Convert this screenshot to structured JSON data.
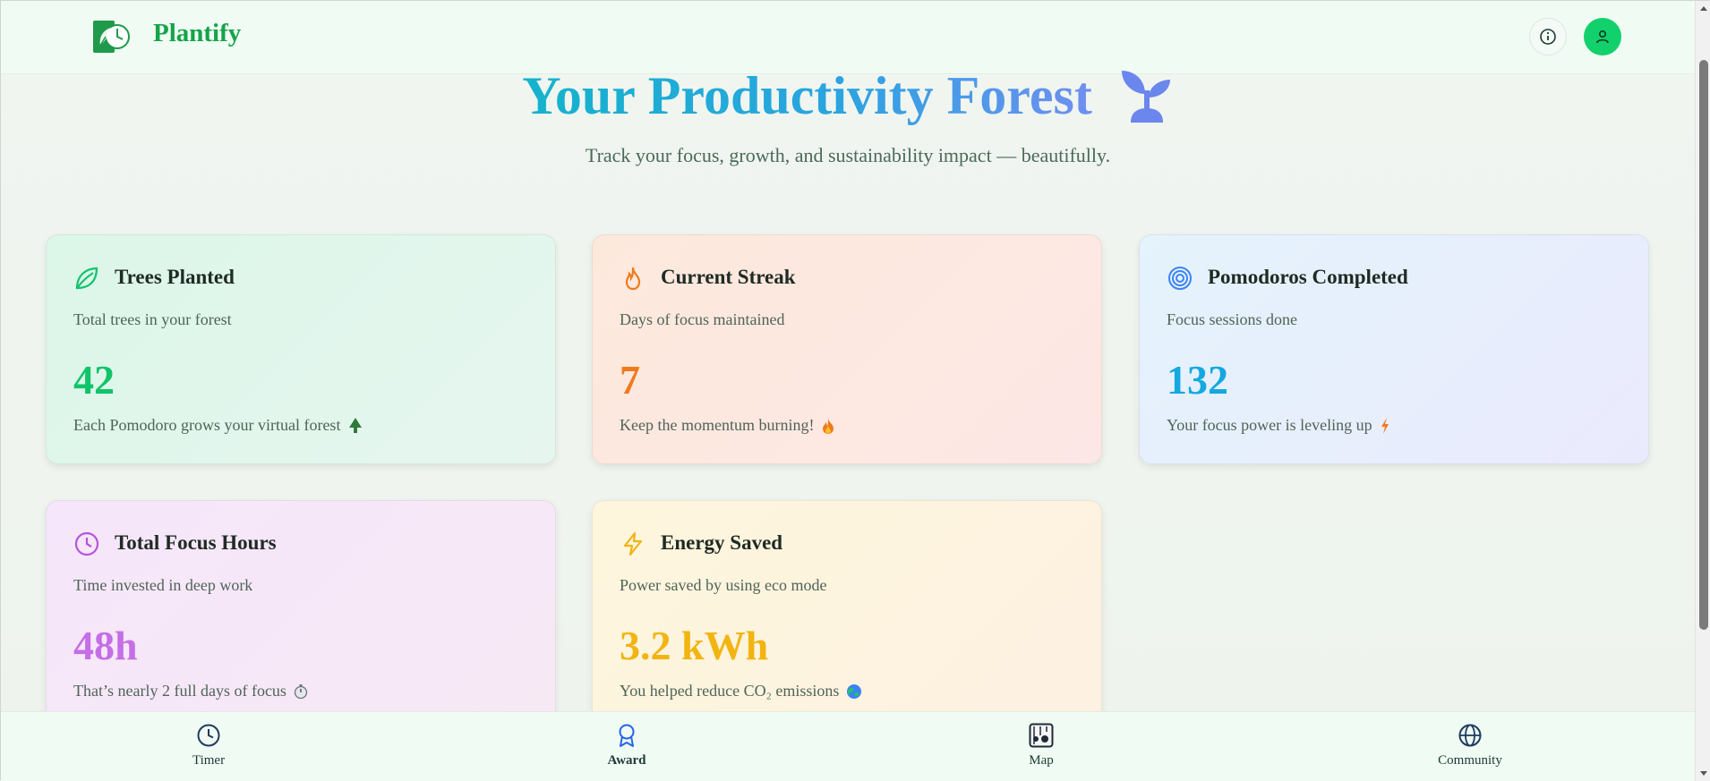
{
  "app": {
    "name": "Plantify"
  },
  "header": {
    "info_icon": "info-icon",
    "profile_icon": "user-icon"
  },
  "hero": {
    "title": "Your Productivity Forest",
    "subtitle": "Track your focus, growth, and sustainability impact — beautifully.",
    "icon": "sprout-icon"
  },
  "cards": [
    {
      "title": "Trees Planted",
      "desc": "Total trees in your forest",
      "value": "42",
      "note": "Each Pomodoro grows your virtual forest",
      "icon": "leaf-icon",
      "note_icon": "tree-icon",
      "color": "#10c46a"
    },
    {
      "title": "Current Streak",
      "desc": "Days of focus maintained",
      "value": "7",
      "note": "Keep the momentum burning!",
      "icon": "flame-icon",
      "note_icon": "fire-icon",
      "color": "#f07a1c"
    },
    {
      "title": "Pomodoros Completed",
      "desc": "Focus sessions done",
      "value": "132",
      "note": "Your focus power is leveling up",
      "icon": "target-icon",
      "note_icon": "lightning-icon",
      "color": "#14a8e0"
    },
    {
      "title": "Total Focus Hours",
      "desc": "Time invested in deep work",
      "value": "48h",
      "note": "That’s nearly 2 full days of focus",
      "icon": "clock-icon",
      "note_icon": "stopwatch-icon",
      "color": "#c56ee6"
    },
    {
      "title": "Energy Saved",
      "desc": "Power saved by using eco mode",
      "value": "3.2 kWh",
      "note": "You helped reduce CO₂ emissions",
      "icon": "bolt-icon",
      "note_icon": "globe-icon",
      "color": "#f2b410"
    }
  ],
  "bottom_nav": [
    {
      "label": "Timer",
      "icon": "clock-icon"
    },
    {
      "label": "Award",
      "icon": "award-icon",
      "active": true
    },
    {
      "label": "Map",
      "icon": "map-icon"
    },
    {
      "label": "Community",
      "icon": "globe-icon"
    }
  ]
}
